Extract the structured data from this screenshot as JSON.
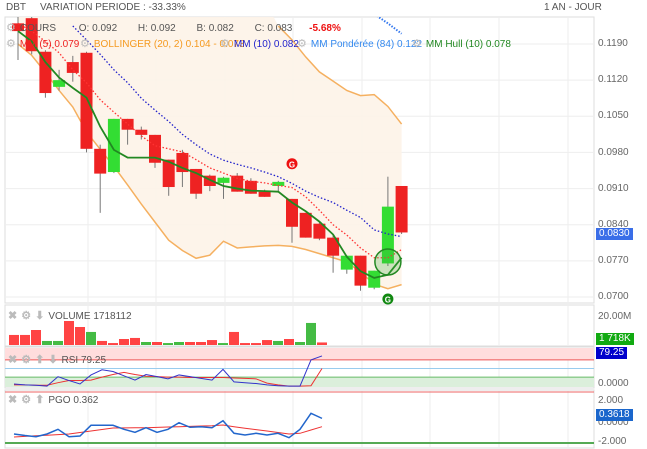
{
  "header": {
    "symbol": "DBT",
    "variation": "VARIATION PERIODE : -33.33%",
    "period": "1 AN - JOUR"
  },
  "legend": {
    "cours": {
      "label": "COURS",
      "open": "O: 0.092",
      "high": "H: 0.092",
      "low": "B: 0.082",
      "close": "C: 0.083",
      "change": "-5.68%"
    },
    "mm5": "MM (5)  0.079",
    "bollinger": "BOLLINGER (20, 2)  0.104 - 0.073",
    "mm10": "MM (10)  0.082",
    "mm_ponderee": "MM Pondérée (84)  0.122",
    "mm_hull": "MM Hull (10)  0.078"
  },
  "colors": {
    "up": "#33dd33",
    "down": "#ee2222",
    "mm5": "#ff3333",
    "mm10": "#2222cc",
    "mm_ponderee": "#3377ee",
    "hull": "#228822",
    "bollinger": "#f5b060",
    "bollinger_fill": "#fdf3e8",
    "price_tag": "#3a6ee8",
    "volume_tag": "#11aa11",
    "rsi_tag": "#0000cc",
    "pgo_tag": "#1a66cc"
  },
  "icons": {
    "settings": "gear-icon",
    "close": "x-icon",
    "move_down": "arrow-down-icon",
    "move_up": "arrow-up-icon",
    "signal": "G-marker-icon"
  },
  "price_axis": {
    "ticks": [
      "0.1190",
      "0.1120",
      "0.1050",
      "0.0980",
      "0.0910",
      "0.0840",
      "0.0770",
      "0.0700"
    ],
    "current": "0.0830"
  },
  "signals": {
    "sell_label": "G",
    "buy_label": "G"
  },
  "volume_panel": {
    "label": "VOLUME  1718112",
    "axis_tick": "20.00M",
    "current": "1 718K"
  },
  "rsi_panel": {
    "label": "RSI  79.25",
    "axis_tick": "0.0000",
    "current": "79.25"
  },
  "pgo_panel": {
    "label": "PGO  0.362",
    "axis_ticks": [
      "2.000",
      "0.0000",
      "-2.000"
    ],
    "current": "0.3618"
  },
  "chart_data": {
    "type": "candlestick",
    "ylim": [
      0.07,
      0.119
    ],
    "candles": [
      {
        "o": 0.123,
        "h": 0.125,
        "l": 0.1159,
        "c": 0.1215
      },
      {
        "o": 0.124,
        "h": 0.125,
        "l": 0.117,
        "c": 0.1176
      },
      {
        "o": 0.1175,
        "h": 0.1178,
        "l": 0.1086,
        "c": 0.1095
      },
      {
        "o": 0.1107,
        "h": 0.114,
        "l": 0.11,
        "c": 0.112
      },
      {
        "o": 0.1155,
        "h": 0.1167,
        "l": 0.1117,
        "c": 0.1134
      },
      {
        "o": 0.1173,
        "h": 0.1175,
        "l": 0.098,
        "c": 0.0987
      },
      {
        "o": 0.0987,
        "h": 0.0995,
        "l": 0.0863,
        "c": 0.0939
      },
      {
        "o": 0.0942,
        "h": 0.1045,
        "l": 0.094,
        "c": 0.1045
      },
      {
        "o": 0.1045,
        "h": 0.1045,
        "l": 0.0995,
        "c": 0.1024
      },
      {
        "o": 0.1024,
        "h": 0.103,
        "l": 0.1005,
        "c": 0.1014
      },
      {
        "o": 0.1014,
        "h": 0.1014,
        "l": 0.095,
        "c": 0.096
      },
      {
        "o": 0.0966,
        "h": 0.0966,
        "l": 0.0896,
        "c": 0.0913
      },
      {
        "o": 0.0979,
        "h": 0.0985,
        "l": 0.0913,
        "c": 0.0942
      },
      {
        "o": 0.0948,
        "h": 0.0948,
        "l": 0.089,
        "c": 0.09
      },
      {
        "o": 0.0935,
        "h": 0.0937,
        "l": 0.0905,
        "c": 0.0915
      },
      {
        "o": 0.0921,
        "h": 0.0933,
        "l": 0.089,
        "c": 0.0931
      },
      {
        "o": 0.0935,
        "h": 0.094,
        "l": 0.0904,
        "c": 0.0904
      },
      {
        "o": 0.0925,
        "h": 0.093,
        "l": 0.09,
        "c": 0.09
      },
      {
        "o": 0.0904,
        "h": 0.0908,
        "l": 0.0894,
        "c": 0.0894
      },
      {
        "o": 0.0915,
        "h": 0.0925,
        "l": 0.0905,
        "c": 0.0923
      },
      {
        "o": 0.089,
        "h": 0.089,
        "l": 0.0805,
        "c": 0.0836
      },
      {
        "o": 0.0863,
        "h": 0.0863,
        "l": 0.0815,
        "c": 0.0815
      },
      {
        "o": 0.0842,
        "h": 0.0845,
        "l": 0.081,
        "c": 0.0813
      },
      {
        "o": 0.0815,
        "h": 0.082,
        "l": 0.0747,
        "c": 0.078
      },
      {
        "o": 0.0753,
        "h": 0.078,
        "l": 0.0745,
        "c": 0.078
      },
      {
        "o": 0.078,
        "h": 0.078,
        "l": 0.0712,
        "c": 0.0722
      },
      {
        "o": 0.0718,
        "h": 0.0751,
        "l": 0.0715,
        "c": 0.0751
      },
      {
        "o": 0.0765,
        "h": 0.0933,
        "l": 0.076,
        "c": 0.0875
      },
      {
        "o": 0.0915,
        "h": 0.0915,
        "l": 0.0822,
        "c": 0.0825
      }
    ],
    "mm5": [
      0.123,
      0.1215,
      0.1195,
      0.1173,
      0.114,
      0.1115,
      0.1082,
      0.1058,
      0.1035,
      0.1012,
      0.0993,
      0.0987,
      0.0981,
      0.0966,
      0.095,
      0.094,
      0.093,
      0.0924,
      0.0921,
      0.0916,
      0.0912,
      0.0894,
      0.0868,
      0.084,
      0.082,
      0.0795,
      0.0776,
      0.0776,
      0.0792
    ],
    "mm10": [
      null,
      null,
      null,
      null,
      0.1225,
      0.1198,
      0.117,
      0.114,
      0.1115,
      0.1085,
      0.1062,
      0.104,
      0.1015,
      0.0995,
      0.0977,
      0.0965,
      0.0957,
      0.095,
      0.0942,
      0.0933,
      0.092,
      0.0905,
      0.0893,
      0.0883,
      0.0868,
      0.0854,
      0.083,
      0.0822,
      0.0817
    ],
    "mm_ponderee": [
      null,
      null,
      null,
      null,
      null,
      null,
      null,
      null,
      null,
      null,
      null,
      null,
      null,
      null,
      null,
      null,
      null,
      null,
      null,
      null,
      null,
      null,
      null,
      null,
      null,
      null,
      0.1248,
      0.123,
      0.121
    ],
    "hull": [
      0.1215,
      0.1195,
      0.1155,
      0.1125,
      0.1105,
      0.1086,
      0.103,
      0.0985,
      0.097,
      0.097,
      0.097,
      0.0962,
      0.095,
      0.094,
      0.0927,
      0.0915,
      0.091,
      0.0906,
      0.0905,
      0.0904,
      0.0883,
      0.0866,
      0.0846,
      0.0821,
      0.0778,
      0.075,
      0.0737,
      0.0743,
      0.0776
    ],
    "bollinger_upper": [
      null,
      null,
      null,
      null,
      null,
      null,
      null,
      null,
      null,
      null,
      null,
      null,
      null,
      null,
      null,
      null,
      null,
      null,
      null,
      0.1225,
      0.1198,
      0.1165,
      0.1136,
      0.1118,
      0.11,
      0.109,
      0.1092,
      0.1069,
      0.1035
    ],
    "bollinger_lower": [
      0.119,
      0.1168,
      0.1135,
      0.11,
      0.1068,
      0.102,
      0.0986,
      0.0953,
      0.0917,
      0.088,
      0.0845,
      0.081,
      0.079,
      0.0775,
      0.0781,
      0.0808,
      0.0795,
      0.0797,
      0.0799,
      0.08,
      0.0798,
      0.0792,
      0.0784,
      0.0776,
      0.0768,
      0.0748,
      0.0725,
      0.0716,
      0.0724
    ],
    "signals": [
      {
        "index": 20,
        "type": "sell",
        "price": 0.0958
      },
      {
        "index": 27,
        "type": "buy",
        "price": 0.07
      }
    ],
    "highlight_index": 27,
    "volume": {
      "unit": "M",
      "ylim": [
        0,
        20
      ],
      "values": [
        6.7,
        6.7,
        10,
        2.7,
        2.7,
        16,
        12,
        8.7,
        2.7,
        1.3,
        4,
        4.7,
        2,
        2,
        1.3,
        2,
        2,
        2,
        3.3,
        1.3,
        8.7,
        1.3,
        1.3,
        3.3,
        2.7,
        4,
        2,
        14.7,
        1.7
      ],
      "direction": [
        "down",
        "down",
        "down",
        "up",
        "up",
        "down",
        "down",
        "up",
        "down",
        "down",
        "down",
        "down",
        "up",
        "down",
        "up",
        "up",
        "down",
        "down",
        "down",
        "up",
        "down",
        "down",
        "down",
        "down",
        "up",
        "down",
        "up",
        "up",
        "down"
      ]
    },
    "rsi": {
      "ylim": [
        0,
        100
      ],
      "levels": [
        70,
        50,
        30
      ],
      "rsi": [
        14,
        12,
        11,
        9,
        31,
        22,
        14,
        35,
        47,
        43,
        33,
        23,
        36,
        31,
        26,
        35,
        31,
        27,
        23,
        48,
        19,
        17,
        15,
        12,
        10,
        9,
        9,
        70,
        79.25
      ],
      "signal": [
        12,
        12,
        11,
        11,
        17,
        22,
        22,
        23,
        30,
        36,
        41,
        36,
        32,
        31,
        30,
        30,
        29,
        29,
        29,
        29,
        28,
        27,
        26,
        16,
        12,
        9,
        9,
        10,
        50
      ]
    },
    "pgo": {
      "ylim": [
        -2.5,
        3.5
      ],
      "levels": [
        3,
        -2.1
      ],
      "pgo": [
        -1.2,
        -1.35,
        -1.47,
        -1.2,
        -0.73,
        -1.47,
        -1.4,
        -0.33,
        -0.33,
        -0.33,
        -0.73,
        -1.03,
        -0.57,
        -1.03,
        -0.73,
        -0.07,
        -0.53,
        -0.47,
        -0.57,
        0.13,
        -1.13,
        -1.3,
        -1.13,
        -1.3,
        -1.13,
        -1.57,
        -0.73,
        0.87,
        0.362
      ],
      "signal": [
        -1.5,
        -1.44,
        -1.38,
        -1.32,
        -1.26,
        -1.2,
        -1.05,
        -0.9,
        -0.75,
        -0.6,
        -0.59,
        -0.58,
        -0.57,
        -0.54,
        -0.5,
        -0.47,
        -0.44,
        -0.4,
        -0.37,
        -0.3,
        -0.47,
        -0.62,
        -0.76,
        -0.9,
        -1.05,
        -1.2,
        -1.13,
        -0.8,
        -0.47
      ]
    }
  }
}
